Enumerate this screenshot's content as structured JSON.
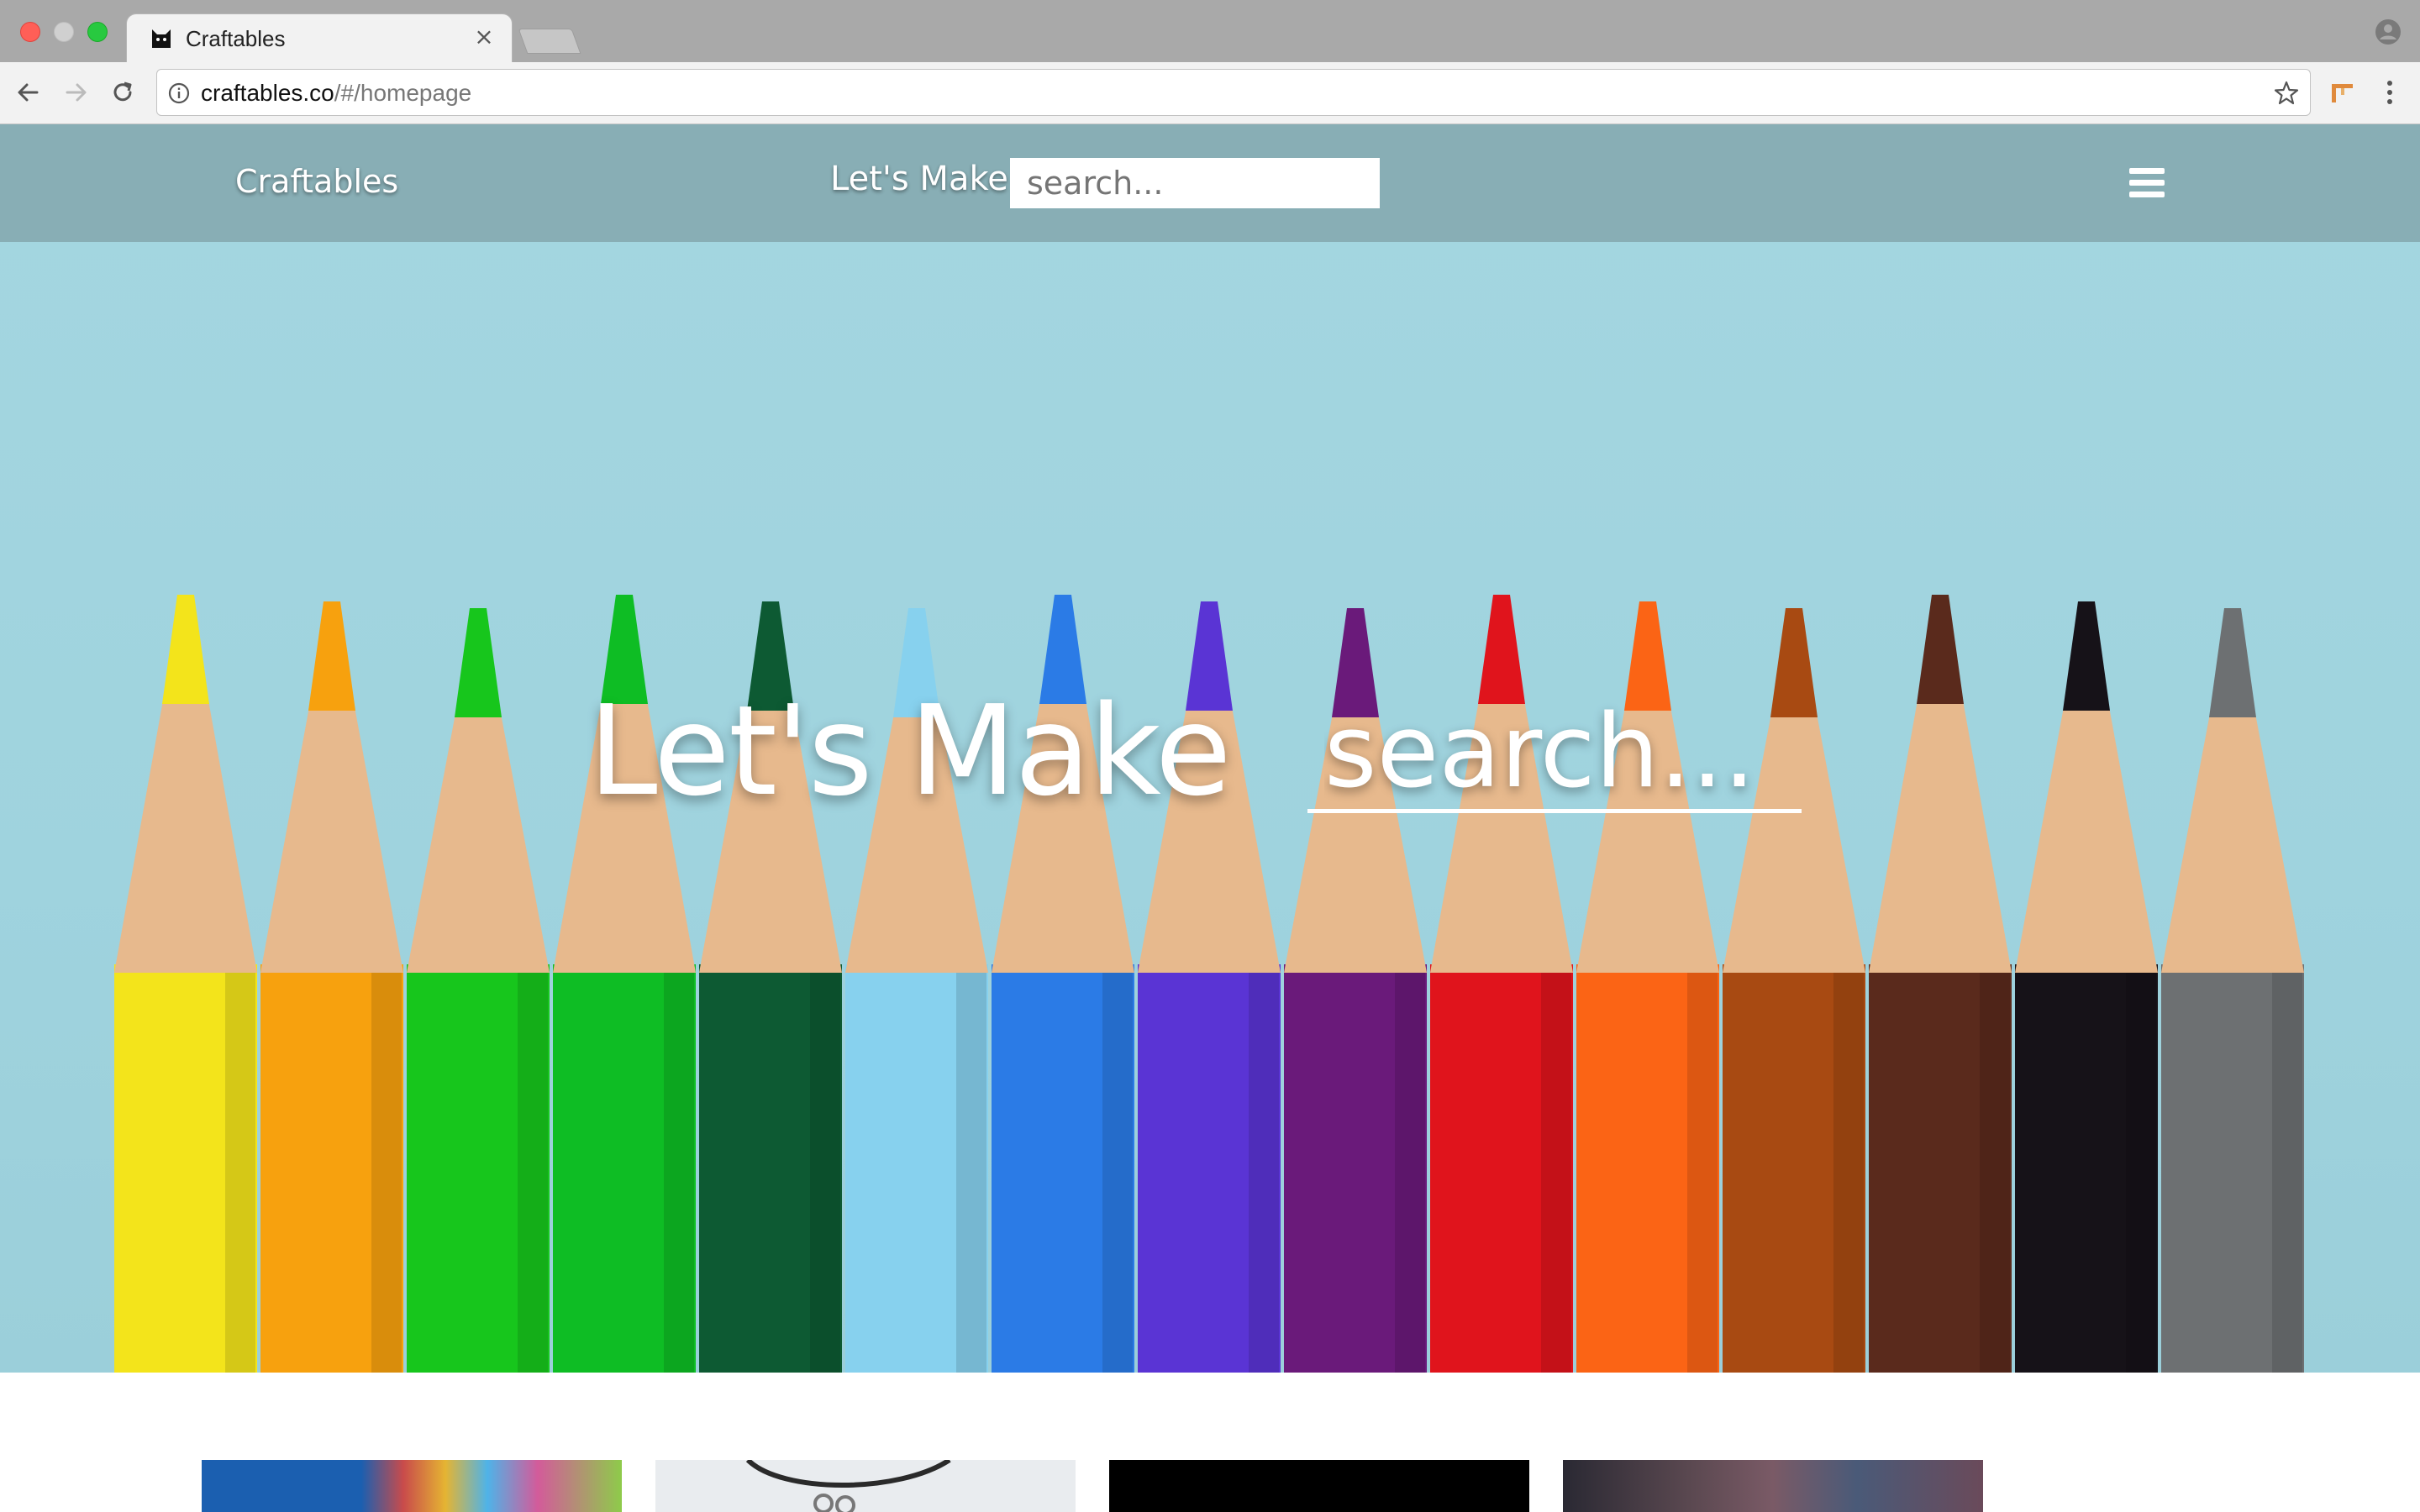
{
  "browser": {
    "tab_title": "Craftables",
    "tab_close_glyph": "×",
    "url_host": "craftables.co",
    "url_path": "/#/homepage",
    "icons": [
      "cat-favicon-icon",
      "back-arrow-icon",
      "forward-arrow-icon",
      "reload-icon",
      "site-info-icon",
      "bookmark-star-icon",
      "extension-icon",
      "browser-menu-icon",
      "profile-icon"
    ]
  },
  "site": {
    "brand": "Craftables",
    "nav_lets_make": "Let's Make",
    "nav_search_placeholder": "search...",
    "hero_title": "Let's Make",
    "hero_search_placeholder": "search...",
    "menu_icon": "hamburger-menu-icon"
  },
  "pencil_colors": [
    "#f3e41b",
    "#f7a10e",
    "#17c61c",
    "#0ebd24",
    "#0d5a33",
    "#87d1ee",
    "#2b7be6",
    "#5a34d4",
    "#6a1a7a",
    "#e0141c",
    "#fb6415",
    "#a84a12",
    "#5a2a1c",
    "#161218",
    "#6d7072"
  ],
  "cards": [
    {
      "name": "balloons-card"
    },
    {
      "name": "necklace-card"
    },
    {
      "name": "dark-card"
    },
    {
      "name": "fabric-card"
    }
  ]
}
